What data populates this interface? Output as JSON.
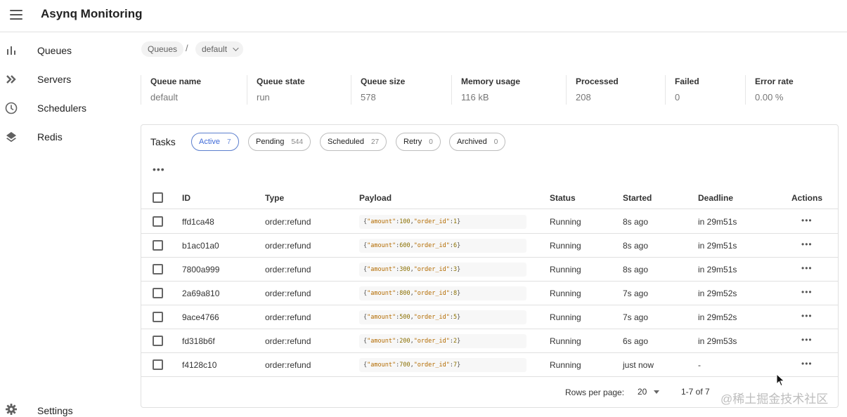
{
  "app": {
    "title": "Asynq Monitoring"
  },
  "sidebar": {
    "items": [
      {
        "label": "Queues",
        "icon": "bar-chart-icon"
      },
      {
        "label": "Servers",
        "icon": "double-chevron-icon"
      },
      {
        "label": "Schedulers",
        "icon": "clock-icon"
      },
      {
        "label": "Redis",
        "icon": "layers-icon"
      }
    ],
    "settings": {
      "label": "Settings",
      "icon": "gear-icon"
    }
  },
  "breadcrumb": {
    "root": "Queues",
    "separator": "/",
    "current": "default"
  },
  "stats": [
    {
      "label": "Queue name",
      "value": "default"
    },
    {
      "label": "Queue state",
      "value": "run"
    },
    {
      "label": "Queue size",
      "value": "578"
    },
    {
      "label": "Memory usage",
      "value": "116 kB"
    },
    {
      "label": "Processed",
      "value": "208"
    },
    {
      "label": "Failed",
      "value": "0"
    },
    {
      "label": "Error rate",
      "value": "0.00 %"
    }
  ],
  "tasks": {
    "title": "Tasks",
    "tabs": [
      {
        "label": "Active",
        "count": "7"
      },
      {
        "label": "Pending",
        "count": "544"
      },
      {
        "label": "Scheduled",
        "count": "27"
      },
      {
        "label": "Retry",
        "count": "0"
      },
      {
        "label": "Archived",
        "count": "0"
      }
    ],
    "columns": {
      "id": "ID",
      "type": "Type",
      "payload": "Payload",
      "status": "Status",
      "started": "Started",
      "deadline": "Deadline",
      "actions": "Actions"
    },
    "rows": [
      {
        "id": "ffd1ca48",
        "type": "order:refund",
        "amount": "100",
        "order_id": "1",
        "status": "Running",
        "started": "8s ago",
        "deadline": "in 29m51s"
      },
      {
        "id": "b1ac01a0",
        "type": "order:refund",
        "amount": "600",
        "order_id": "6",
        "status": "Running",
        "started": "8s ago",
        "deadline": "in 29m51s"
      },
      {
        "id": "7800a999",
        "type": "order:refund",
        "amount": "300",
        "order_id": "3",
        "status": "Running",
        "started": "8s ago",
        "deadline": "in 29m51s"
      },
      {
        "id": "2a69a810",
        "type": "order:refund",
        "amount": "800",
        "order_id": "8",
        "status": "Running",
        "started": "7s ago",
        "deadline": "in 29m52s"
      },
      {
        "id": "9ace4766",
        "type": "order:refund",
        "amount": "500",
        "order_id": "5",
        "status": "Running",
        "started": "7s ago",
        "deadline": "in 29m52s"
      },
      {
        "id": "fd318b6f",
        "type": "order:refund",
        "amount": "200",
        "order_id": "2",
        "status": "Running",
        "started": "6s ago",
        "deadline": "in 29m53s"
      },
      {
        "id": "f4128c10",
        "type": "order:refund",
        "amount": "700",
        "order_id": "7",
        "status": "Running",
        "started": "just now",
        "deadline": "-"
      }
    ],
    "payload_keys": {
      "amount": "\"amount\"",
      "order_id": "\"order_id\""
    },
    "footer": {
      "rows_per_page_label": "Rows per page:",
      "rows_per_page_value": "20",
      "range": "1-7 of 7"
    }
  },
  "watermark": "@稀土掘金技术社区",
  "colors": {
    "active_tab": "#3f6ad8",
    "payload_key": "#b36b00"
  }
}
